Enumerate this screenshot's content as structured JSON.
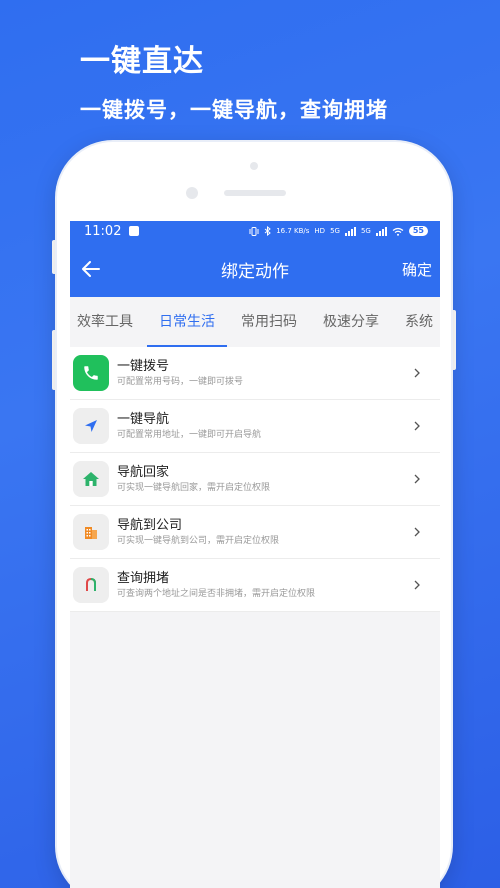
{
  "promo": {
    "title": "一键直达",
    "subtitle": "一键拨号，一键导航，查询拥堵"
  },
  "status_bar": {
    "time": "11:02",
    "network_speed": "16.7 KB/s",
    "hd_label": "HD",
    "signal_1": "5G",
    "signal_2": "5G",
    "battery": "55"
  },
  "app_bar": {
    "title": "绑定动作",
    "confirm_label": "确定"
  },
  "tabs": [
    {
      "label": "效率工具",
      "active": false
    },
    {
      "label": "日常生活",
      "active": true
    },
    {
      "label": "常用扫码",
      "active": false
    },
    {
      "label": "极速分享",
      "active": false
    },
    {
      "label": "系统",
      "active": false
    }
  ],
  "items": [
    {
      "title": "一键拨号",
      "desc": "可配置常用号码，一键即可拨号",
      "icon": "phone-icon"
    },
    {
      "title": "一键导航",
      "desc": "可配置常用地址，一键即可开启导航",
      "icon": "navigation-icon"
    },
    {
      "title": "导航回家",
      "desc": "可实现一键导航回家，需开启定位权限",
      "icon": "home-icon"
    },
    {
      "title": "导航到公司",
      "desc": "可实现一键导航到公司，需开启定位权限",
      "icon": "office-building-icon"
    },
    {
      "title": "查询拥堵",
      "desc": "可查询两个地址之间是否非拥堵，需开启定位权限",
      "icon": "traffic-route-icon"
    }
  ],
  "colors": {
    "brand_blue": "#2f6ef0",
    "phone_green": "#20c05c",
    "home_green": "#2db36b",
    "office_orange": "#f08a24"
  }
}
